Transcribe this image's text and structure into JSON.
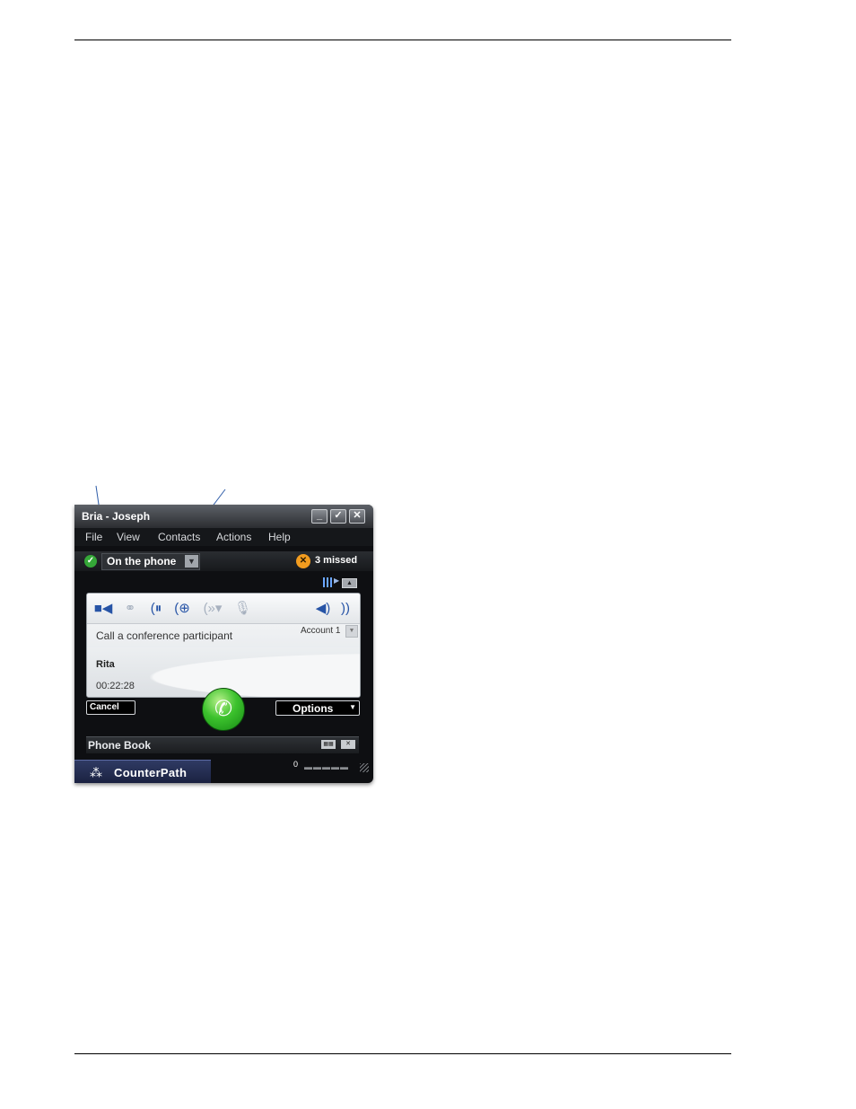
{
  "window": {
    "title": "Bria - Joseph",
    "controls": [
      "minimize-icon",
      "compact-icon",
      "close-icon"
    ]
  },
  "menu": {
    "items": [
      "File",
      "View",
      "Contacts",
      "Actions",
      "Help"
    ]
  },
  "status": {
    "presence": "On the phone",
    "missed": "3 missed"
  },
  "call_panel": {
    "toolbar_icons": [
      "video-icon",
      "conference-icon",
      "hold-icon",
      "add-call-icon",
      "transfer-icon",
      "mute-icon",
      "speaker-icon",
      "volume-icon"
    ],
    "hint": "Call a conference participant",
    "account": "Account 1",
    "party": "Rita",
    "duration": "00:22:28"
  },
  "actions": {
    "cancel": "Cancel",
    "options": "Options"
  },
  "phonebook": {
    "label": "Phone Book"
  },
  "brand": {
    "name": "CounterPath"
  },
  "colors": {
    "window_bg": "#0e0f12",
    "accent_blue": "#2754a6",
    "call_green": "#3cc22d",
    "missed_orange": "#f29c1f"
  }
}
